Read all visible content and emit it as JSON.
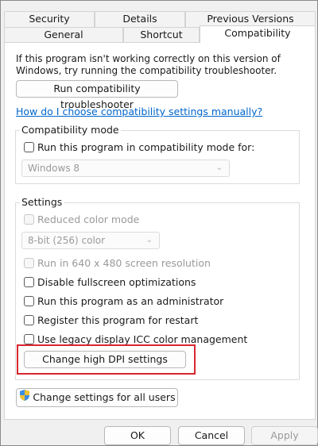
{
  "tabs": {
    "security": "Security",
    "details": "Details",
    "previous_versions": "Previous Versions",
    "general": "General",
    "shortcut": "Shortcut",
    "compatibility": "Compatibility"
  },
  "intro_text": "If this program isn't working correctly on this version of Windows, try running the compatibility troubleshooter.",
  "troubleshooter_button": "Run compatibility troubleshooter",
  "help_link": "How do I choose compatibility settings manually?",
  "compatibility_mode": {
    "group_label": "Compatibility mode",
    "checkbox_label": "Run this program in compatibility mode for:",
    "checked": false,
    "os_select_value": "Windows 8"
  },
  "settings": {
    "group_label": "Settings",
    "reduced_color_label": "Reduced color mode",
    "color_select_value": "8-bit (256) color",
    "run_640_label": "Run in 640 x 480 screen resolution",
    "disable_fullscreen_label": "Disable fullscreen optimizations",
    "run_admin_label": "Run this program as an administrator",
    "register_restart_label": "Register this program for restart",
    "legacy_icc_label": "Use legacy display ICC color management",
    "change_dpi_button": "Change high DPI settings"
  },
  "change_all_users_button": "Change settings for all users",
  "dialog_buttons": {
    "ok": "OK",
    "cancel": "Cancel",
    "apply": "Apply"
  },
  "colors": {
    "highlight_border": "#d9262f",
    "link": "#0066cc",
    "disabled_text": "#9a9a9a"
  },
  "icons": {
    "uac_shield": "uac-shield-icon",
    "dropdown": "chevron-down-icon"
  }
}
